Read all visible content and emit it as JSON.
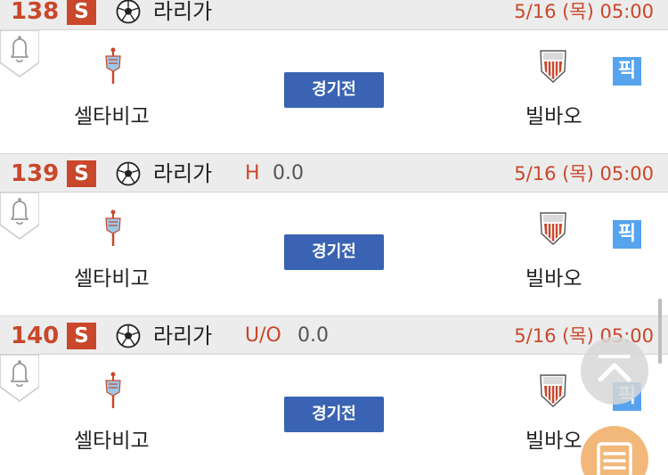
{
  "matches": [
    {
      "number": "138",
      "sport_badge": "S",
      "sport_icon": "soccer-ball-icon",
      "league": "라리가",
      "market": "",
      "market_value": "",
      "datetime": "5/16 (목)  05:00",
      "home_team": "셀타비고",
      "away_team": "빌바오",
      "status_label": "경기전",
      "pick_label": "픽"
    },
    {
      "number": "139",
      "sport_badge": "S",
      "sport_icon": "soccer-ball-icon",
      "league": "라리가",
      "market": "H",
      "market_value": "0.0",
      "datetime": "5/16 (목)  05:00",
      "home_team": "셀타비고",
      "away_team": "빌바오",
      "status_label": "경기전",
      "pick_label": "픽"
    },
    {
      "number": "140",
      "sport_badge": "S",
      "sport_icon": "soccer-ball-icon",
      "league": "라리가",
      "market": "U/O",
      "market_value": "0.0",
      "datetime": "5/16 (목)  05:00",
      "home_team": "셀타비고",
      "away_team": "빌바오",
      "status_label": "경기전",
      "pick_label": "픽"
    }
  ],
  "colors": {
    "accent_red": "#c9472a",
    "status_blue": "#3a63b3",
    "pick_blue": "#56a3ee",
    "header_gray": "#ececec",
    "fab_orange": "#f2b87a"
  },
  "floating_buttons": {
    "scroll_top_icon": "chevron-up-icon",
    "menu_icon": "list-icon"
  }
}
